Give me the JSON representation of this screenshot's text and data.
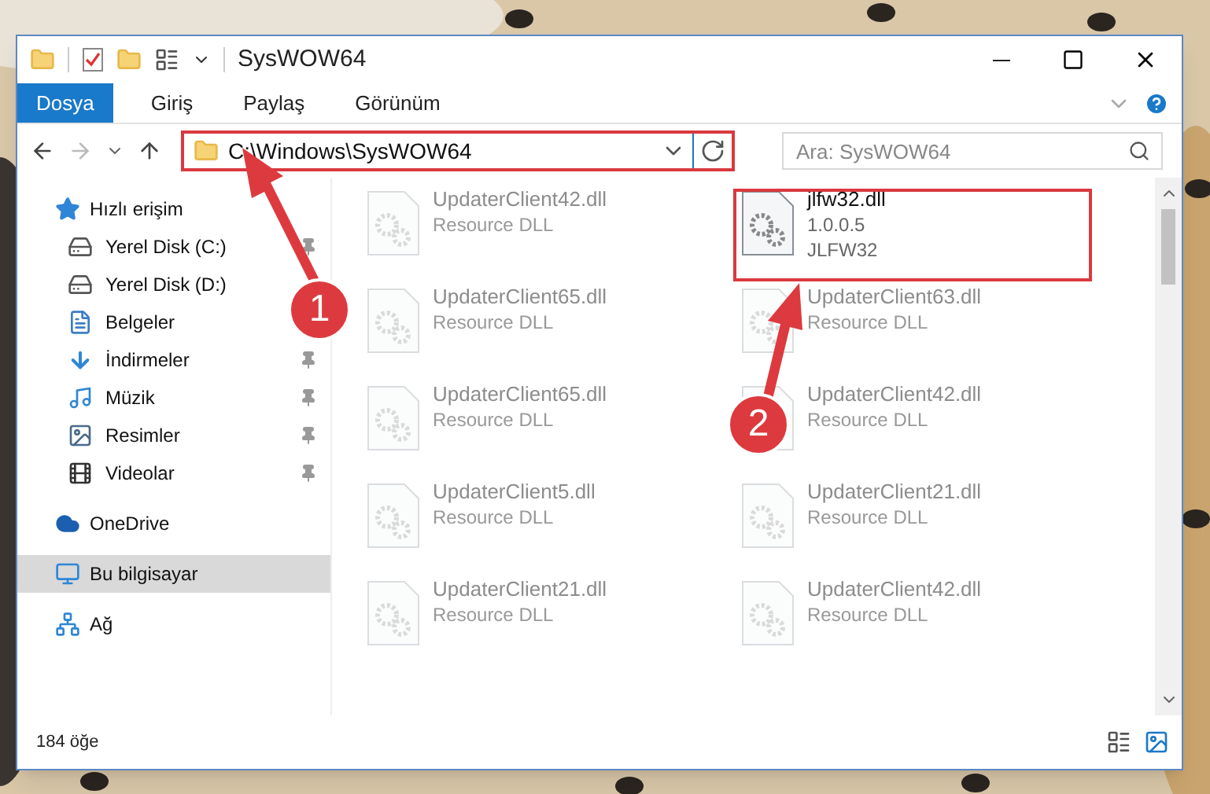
{
  "window": {
    "title": "SysWOW64"
  },
  "ribbon_tabs": [
    {
      "label": "Dosya",
      "selected": true
    },
    {
      "label": "Giriş",
      "selected": false
    },
    {
      "label": "Paylaş",
      "selected": false
    },
    {
      "label": "Görünüm",
      "selected": false
    }
  ],
  "address": {
    "value": "C:\\Windows\\SysWOW64"
  },
  "search": {
    "placeholder": "Ara: SysWOW64"
  },
  "sidebar": {
    "items": [
      {
        "label": "Hızlı erişim",
        "selected": false,
        "children": [
          {
            "label": "Yerel Disk (C:)",
            "pinned": true
          },
          {
            "label": "Yerel Disk (D:)",
            "pinned": false
          },
          {
            "label": "Belgeler",
            "pinned": false
          },
          {
            "label": "İndirmeler",
            "pinned": true
          },
          {
            "label": "Müzik",
            "pinned": true
          },
          {
            "label": "Resimler",
            "pinned": true
          },
          {
            "label": "Videolar",
            "pinned": true
          }
        ]
      },
      {
        "label": "OneDrive",
        "selected": false
      },
      {
        "label": "Bu bilgisayar",
        "selected": true
      },
      {
        "label": "Ağ",
        "selected": false
      }
    ]
  },
  "files": [
    {
      "name": "UpdaterClient42.dll",
      "lines": [
        "Resource DLL"
      ],
      "faded": true
    },
    {
      "name": "jlfw32.dll",
      "lines": [
        "1.0.0.5",
        "JLFW32"
      ],
      "faded": false
    },
    {
      "name": "UpdaterClient65.dll",
      "lines": [
        "Resource DLL"
      ],
      "faded": true
    },
    {
      "name": "UpdaterClient63.dll",
      "lines": [
        "Resource DLL"
      ],
      "faded": true
    },
    {
      "name": "UpdaterClient65.dll",
      "lines": [
        "Resource DLL"
      ],
      "faded": true
    },
    {
      "name": "UpdaterClient42.dll",
      "lines": [
        "Resource DLL"
      ],
      "faded": true
    },
    {
      "name": "UpdaterClient5.dll",
      "lines": [
        "Resource DLL"
      ],
      "faded": true
    },
    {
      "name": "UpdaterClient21.dll",
      "lines": [
        "Resource DLL"
      ],
      "faded": true
    },
    {
      "name": "UpdaterClient21.dll",
      "lines": [
        "Resource DLL"
      ],
      "faded": true
    },
    {
      "name": "UpdaterClient42.dll",
      "lines": [
        "Resource DLL"
      ],
      "faded": true
    }
  ],
  "status_bar": {
    "count": "184 öğe"
  },
  "callouts": [
    {
      "number": "1"
    },
    {
      "number": "2"
    }
  ]
}
